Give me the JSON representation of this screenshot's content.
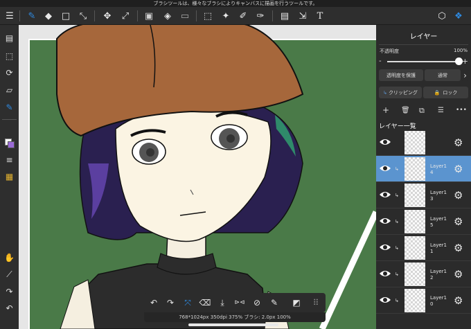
{
  "tooltip": "ブラシツールは、様々なブラシによりキャンバスに描画を行うツールです。",
  "toolbar": {
    "menu_icon": "☰",
    "brush_icon": "✎",
    "eraser_icon": "◆",
    "shape_icon": "□",
    "grad_icon": "⤡",
    "move_icon": "✥",
    "transform_icon": "⤢",
    "fill_icon": "▣",
    "bucket_icon": "◈",
    "gradient_icon": "▭",
    "select_icon": "⬚",
    "wand_icon": "✦",
    "selpen_icon": "✐",
    "selerase_icon": "✑",
    "filter_icon": "▤",
    "grab_icon": "⇲",
    "text_icon": "T",
    "material_icon": "⬡",
    "layers_icon": "❖"
  },
  "sidebar": {
    "pages_icon": "▤",
    "select_icon": "⬚",
    "rotate_icon": "⟳",
    "ruler_icon": "▱",
    "pen_icon": "✎",
    "color_icon": "■",
    "layer_icon": "≡",
    "palette_icon": "▦",
    "hand_icon": "✋",
    "dropper_icon": "⟋",
    "redo_icon": "↷",
    "undo_icon": "↶"
  },
  "layer_panel": {
    "title": "レイヤー",
    "opacity_label": "不透明度",
    "opacity_value": "100%",
    "opacity_fraction": 1.0,
    "minus": "-",
    "plus": "+",
    "protect_alpha": "透明度を保護",
    "blend_mode": "通常",
    "more_arrow": "›",
    "clipping": "クリッピング",
    "lock": "ロック",
    "add_icon": "+",
    "delete_icon": "🗑",
    "dup_icon": "⧉",
    "list_icon": "☰",
    "more_icon": "•••",
    "list_title": "レイヤー一覧",
    "layers": [
      {
        "name": "",
        "selected": false,
        "clip": false
      },
      {
        "name": "Layer14",
        "selected": true,
        "clip": true
      },
      {
        "name": "Layer13",
        "selected": false,
        "clip": true
      },
      {
        "name": "Layer15",
        "selected": false,
        "clip": true
      },
      {
        "name": "Layer11",
        "selected": false,
        "clip": true
      },
      {
        "name": "Layer12",
        "selected": false,
        "clip": true
      },
      {
        "name": "Layer10",
        "selected": false,
        "clip": true
      }
    ]
  },
  "bottom_bar": {
    "undo": "↶",
    "redo": "↷",
    "transform": "⤧",
    "eraser": "⌫",
    "import": "⤓",
    "flip": "⊳⊲",
    "no_icon": "⊘",
    "edit": "✎",
    "save": "◩",
    "grip": "⠿"
  },
  "status": "768*1024px 350dpi 375% ブラシ: 2.0px 100%",
  "colors": {
    "accent": "#2f8ae0",
    "selected_layer": "#5b94cf",
    "canvas_bg": "#4a7a48"
  }
}
